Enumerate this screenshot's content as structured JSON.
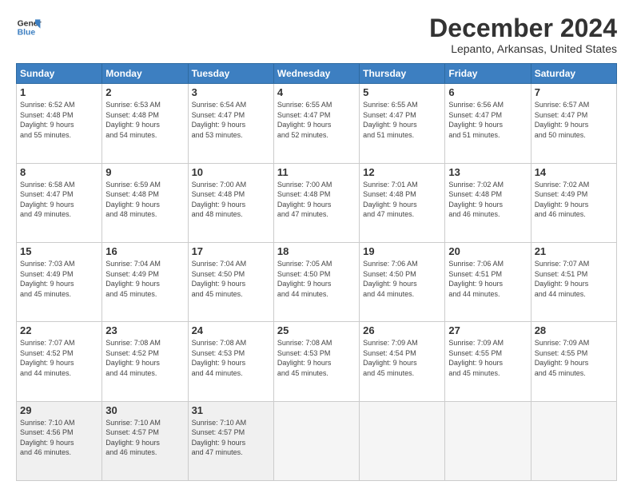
{
  "header": {
    "logo_line1": "General",
    "logo_line2": "Blue",
    "month": "December 2024",
    "location": "Lepanto, Arkansas, United States"
  },
  "days_of_week": [
    "Sunday",
    "Monday",
    "Tuesday",
    "Wednesday",
    "Thursday",
    "Friday",
    "Saturday"
  ],
  "weeks": [
    [
      {
        "day": "1",
        "info": "Sunrise: 6:52 AM\nSunset: 4:48 PM\nDaylight: 9 hours\nand 55 minutes."
      },
      {
        "day": "2",
        "info": "Sunrise: 6:53 AM\nSunset: 4:48 PM\nDaylight: 9 hours\nand 54 minutes."
      },
      {
        "day": "3",
        "info": "Sunrise: 6:54 AM\nSunset: 4:47 PM\nDaylight: 9 hours\nand 53 minutes."
      },
      {
        "day": "4",
        "info": "Sunrise: 6:55 AM\nSunset: 4:47 PM\nDaylight: 9 hours\nand 52 minutes."
      },
      {
        "day": "5",
        "info": "Sunrise: 6:55 AM\nSunset: 4:47 PM\nDaylight: 9 hours\nand 51 minutes."
      },
      {
        "day": "6",
        "info": "Sunrise: 6:56 AM\nSunset: 4:47 PM\nDaylight: 9 hours\nand 51 minutes."
      },
      {
        "day": "7",
        "info": "Sunrise: 6:57 AM\nSunset: 4:47 PM\nDaylight: 9 hours\nand 50 minutes."
      }
    ],
    [
      {
        "day": "8",
        "info": "Sunrise: 6:58 AM\nSunset: 4:47 PM\nDaylight: 9 hours\nand 49 minutes."
      },
      {
        "day": "9",
        "info": "Sunrise: 6:59 AM\nSunset: 4:48 PM\nDaylight: 9 hours\nand 48 minutes."
      },
      {
        "day": "10",
        "info": "Sunrise: 7:00 AM\nSunset: 4:48 PM\nDaylight: 9 hours\nand 48 minutes."
      },
      {
        "day": "11",
        "info": "Sunrise: 7:00 AM\nSunset: 4:48 PM\nDaylight: 9 hours\nand 47 minutes."
      },
      {
        "day": "12",
        "info": "Sunrise: 7:01 AM\nSunset: 4:48 PM\nDaylight: 9 hours\nand 47 minutes."
      },
      {
        "day": "13",
        "info": "Sunrise: 7:02 AM\nSunset: 4:48 PM\nDaylight: 9 hours\nand 46 minutes."
      },
      {
        "day": "14",
        "info": "Sunrise: 7:02 AM\nSunset: 4:49 PM\nDaylight: 9 hours\nand 46 minutes."
      }
    ],
    [
      {
        "day": "15",
        "info": "Sunrise: 7:03 AM\nSunset: 4:49 PM\nDaylight: 9 hours\nand 45 minutes."
      },
      {
        "day": "16",
        "info": "Sunrise: 7:04 AM\nSunset: 4:49 PM\nDaylight: 9 hours\nand 45 minutes."
      },
      {
        "day": "17",
        "info": "Sunrise: 7:04 AM\nSunset: 4:50 PM\nDaylight: 9 hours\nand 45 minutes."
      },
      {
        "day": "18",
        "info": "Sunrise: 7:05 AM\nSunset: 4:50 PM\nDaylight: 9 hours\nand 44 minutes."
      },
      {
        "day": "19",
        "info": "Sunrise: 7:06 AM\nSunset: 4:50 PM\nDaylight: 9 hours\nand 44 minutes."
      },
      {
        "day": "20",
        "info": "Sunrise: 7:06 AM\nSunset: 4:51 PM\nDaylight: 9 hours\nand 44 minutes."
      },
      {
        "day": "21",
        "info": "Sunrise: 7:07 AM\nSunset: 4:51 PM\nDaylight: 9 hours\nand 44 minutes."
      }
    ],
    [
      {
        "day": "22",
        "info": "Sunrise: 7:07 AM\nSunset: 4:52 PM\nDaylight: 9 hours\nand 44 minutes."
      },
      {
        "day": "23",
        "info": "Sunrise: 7:08 AM\nSunset: 4:52 PM\nDaylight: 9 hours\nand 44 minutes."
      },
      {
        "day": "24",
        "info": "Sunrise: 7:08 AM\nSunset: 4:53 PM\nDaylight: 9 hours\nand 44 minutes."
      },
      {
        "day": "25",
        "info": "Sunrise: 7:08 AM\nSunset: 4:53 PM\nDaylight: 9 hours\nand 45 minutes."
      },
      {
        "day": "26",
        "info": "Sunrise: 7:09 AM\nSunset: 4:54 PM\nDaylight: 9 hours\nand 45 minutes."
      },
      {
        "day": "27",
        "info": "Sunrise: 7:09 AM\nSunset: 4:55 PM\nDaylight: 9 hours\nand 45 minutes."
      },
      {
        "day": "28",
        "info": "Sunrise: 7:09 AM\nSunset: 4:55 PM\nDaylight: 9 hours\nand 45 minutes."
      }
    ],
    [
      {
        "day": "29",
        "info": "Sunrise: 7:10 AM\nSunset: 4:56 PM\nDaylight: 9 hours\nand 46 minutes."
      },
      {
        "day": "30",
        "info": "Sunrise: 7:10 AM\nSunset: 4:57 PM\nDaylight: 9 hours\nand 46 minutes."
      },
      {
        "day": "31",
        "info": "Sunrise: 7:10 AM\nSunset: 4:57 PM\nDaylight: 9 hours\nand 47 minutes."
      },
      {
        "day": "",
        "info": ""
      },
      {
        "day": "",
        "info": ""
      },
      {
        "day": "",
        "info": ""
      },
      {
        "day": "",
        "info": ""
      }
    ]
  ]
}
